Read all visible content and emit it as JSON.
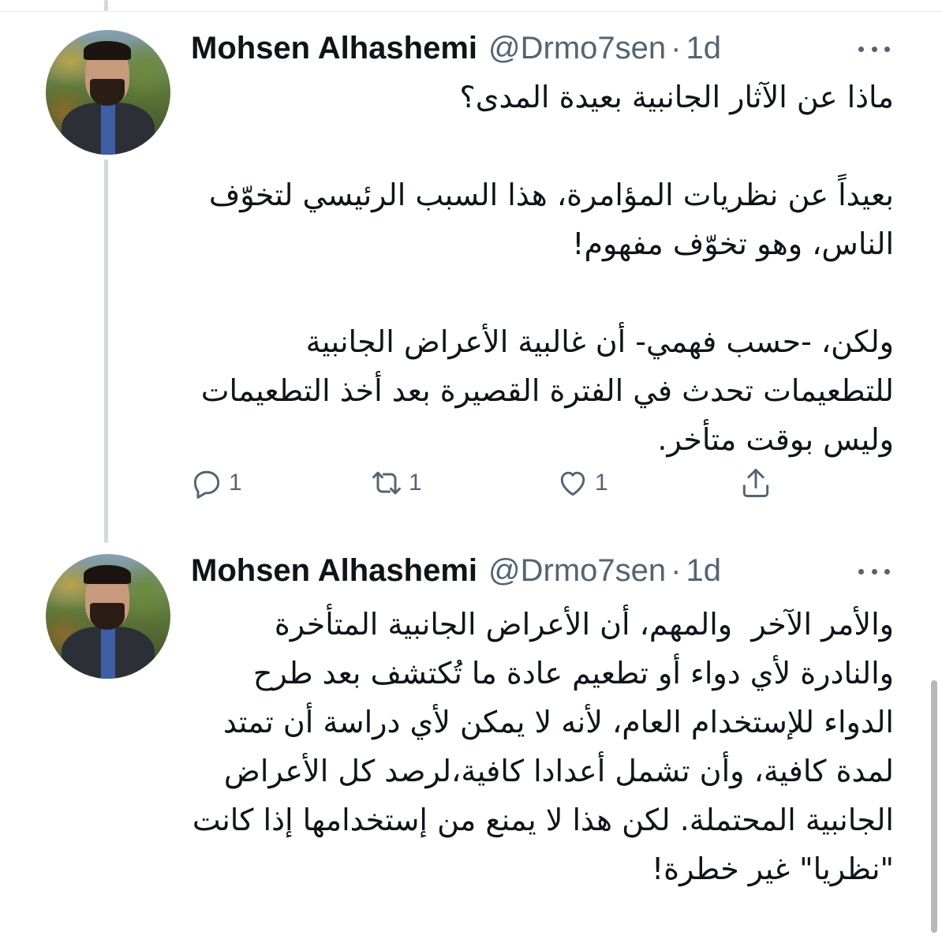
{
  "tweets": [
    {
      "author_name": "Mohsen Alhashemi",
      "handle": "@Drmo7sen",
      "separator": "·",
      "time": "1d",
      "text": "ماذا عن الآثار الجانبية بعيدة المدى؟\n\nبعيداً عن نظريات المؤامرة، هذا السبب الرئيسي لتخوّف الناس، وهو تخوّف مفهوم!\n\nولكن، -حسب فهمي- أن غالبية الأعراض الجانبية للتطعيمات تحدث في الفترة القصيرة بعد أخذ التطعيمات وليس بوقت متأخر.",
      "reply_count": "1",
      "retweet_count": "1",
      "like_count": "1"
    },
    {
      "author_name": "Mohsen Alhashemi",
      "handle": "@Drmo7sen",
      "separator": "·",
      "time": "1d",
      "text": "والأمر الآخر  والمهم، أن الأعراض الجانبية المتأخرة والنادرة لأي دواء أو تطعيم عادة ما تُكتشف بعد طرح الدواء للإستخدام العام، لأنه لا يمكن لأي دراسة أن تمتد لمدة كافية، وأن تشمل أعدادا كافية،لرصد كل الأعراض الجانبية المحتملة. لكن هذا لا يمنع من إستخدامها إذا كانت \"نظريا\" غير خطرة!"
    }
  ],
  "icons": {
    "reply": "speech-bubble-icon",
    "retweet": "retweet-arrows-icon",
    "like": "heart-icon",
    "share": "share-upload-icon",
    "more": "three-dots-icon"
  },
  "colors": {
    "text": "#0f1419",
    "secondary": "#536471",
    "thread_line": "#cfd9de",
    "background": "#ffffff"
  }
}
